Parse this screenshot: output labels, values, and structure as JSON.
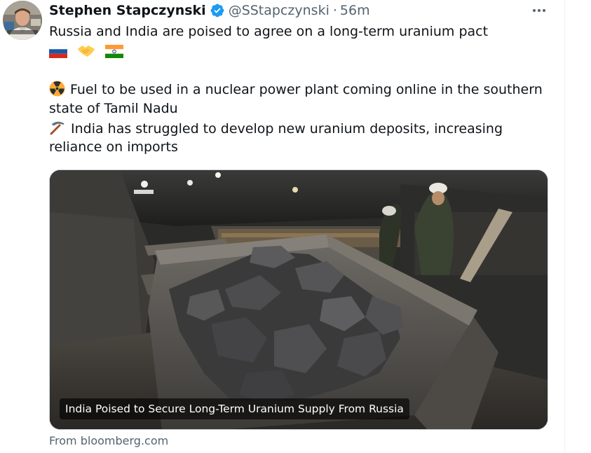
{
  "tweet": {
    "author_name": "Stephen Stapczynski",
    "handle": "@SStapczynski",
    "separator": "·",
    "time_ago": "56m",
    "verified": true,
    "text_line_1": "Russia and India are poised to agree on a long-term uranium pact",
    "emojis_line": [
      "russia-flag-icon",
      "handshake-icon",
      "india-flag-icon"
    ],
    "bullet_1_icon": "radioactive-icon",
    "bullet_1_line_1": "Fuel to be used in a nuclear power plant coming online in the southern",
    "bullet_1_line_2": "state of Tamil Nadu",
    "bullet_2_icon": "pick-icon",
    "bullet_2_line_1": "India has struggled to develop new uranium deposits, increasing",
    "bullet_2_line_2": "reliance on imports"
  },
  "card": {
    "image": "uranium-mine-cart-photo",
    "headline": "India Poised to Secure Long-Term Uranium Supply From Russia",
    "source": "From bloomberg.com"
  },
  "colors": {
    "text": "#0f1419",
    "secondary": "#536471",
    "verified_blue": "#1d9bf0",
    "border": "#cfd9de"
  }
}
